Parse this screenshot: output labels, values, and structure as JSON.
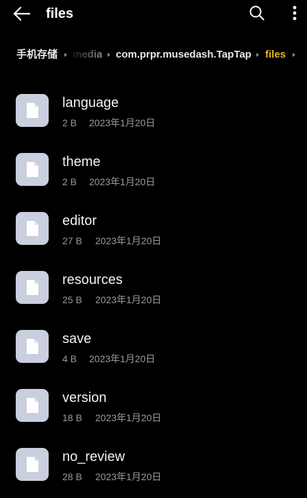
{
  "header": {
    "title": "files",
    "back_icon": "arrow-left-icon",
    "search_icon": "search-icon",
    "more_icon": "more-vertical-icon"
  },
  "breadcrumb": {
    "items": [
      {
        "label": "手机存储"
      },
      {
        "label": "media"
      },
      {
        "label": "com.prpr.musedash.TapTap"
      },
      {
        "label": "files"
      }
    ],
    "separator_icon": "chevron-right-icon",
    "active_color": "#e6b52a"
  },
  "files": [
    {
      "name": "language",
      "size": "2 B",
      "date": "2023年1月20日"
    },
    {
      "name": "theme",
      "size": "2 B",
      "date": "2023年1月20日"
    },
    {
      "name": "editor",
      "size": "27 B",
      "date": "2023年1月20日"
    },
    {
      "name": "resources",
      "size": "25 B",
      "date": "2023年1月20日"
    },
    {
      "name": "save",
      "size": "4 B",
      "date": "2023年1月20日"
    },
    {
      "name": "version",
      "size": "18 B",
      "date": "2023年1月20日"
    },
    {
      "name": "no_review",
      "size": "28 B",
      "date": "2023年1月20日"
    }
  ],
  "file_icon": "document-icon",
  "colors": {
    "background": "#000000",
    "icon_tile": "#c9cfdf",
    "secondary_text": "#9a9a9a"
  }
}
